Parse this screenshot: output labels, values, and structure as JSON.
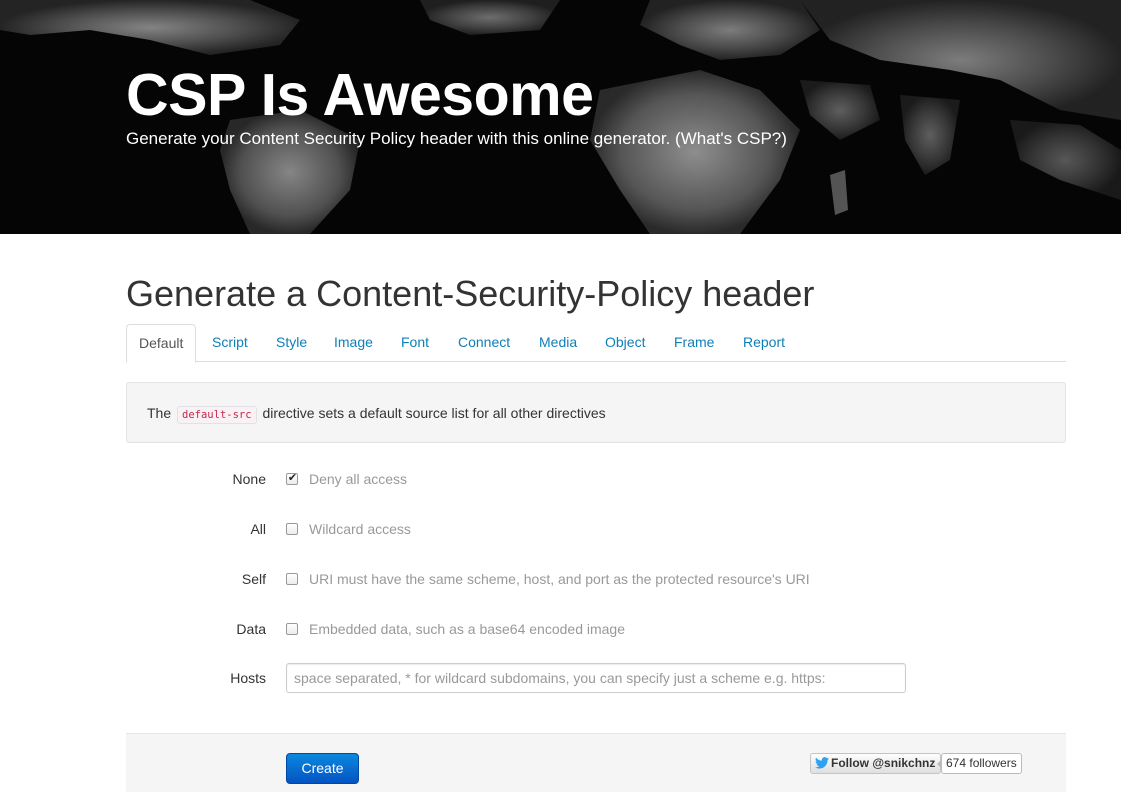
{
  "header": {
    "title": "CSP Is Awesome",
    "subtitle": "Generate your Content Security Policy header with this online generator. (What's CSP?)"
  },
  "main": {
    "heading": "Generate a Content-Security-Policy header",
    "tabs": [
      {
        "label": "Default",
        "active": true
      },
      {
        "label": "Script"
      },
      {
        "label": "Style"
      },
      {
        "label": "Image"
      },
      {
        "label": "Font"
      },
      {
        "label": "Connect"
      },
      {
        "label": "Media"
      },
      {
        "label": "Object"
      },
      {
        "label": "Frame"
      },
      {
        "label": "Report"
      }
    ],
    "info": {
      "prefix": "The",
      "code": "default-src",
      "suffix": "directive sets a default source list for all other directives"
    },
    "options": [
      {
        "label": "None",
        "description": "Deny all access",
        "checked": true
      },
      {
        "label": "All",
        "description": "Wildcard access",
        "checked": false
      },
      {
        "label": "Self",
        "description": "URI must have the same scheme, host, and port as the protected resource's URI",
        "checked": false
      },
      {
        "label": "Data",
        "description": "Embedded data, such as a base64 encoded image",
        "checked": false
      }
    ],
    "hosts": {
      "label": "Hosts",
      "value": "",
      "placeholder": "space separated, * for wildcard subdomains, you can specify just a scheme e.g. https:"
    }
  },
  "actions": {
    "create_label": "Create",
    "follow_label": "Follow @snikchnz",
    "followers": "674 followers"
  },
  "colors": {
    "link": "#0f7fb8",
    "primary_button": "#0454c4",
    "hero_background": "#050505"
  },
  "icons": {
    "check": "check-icon",
    "twitter": "twitter-bird-icon"
  }
}
